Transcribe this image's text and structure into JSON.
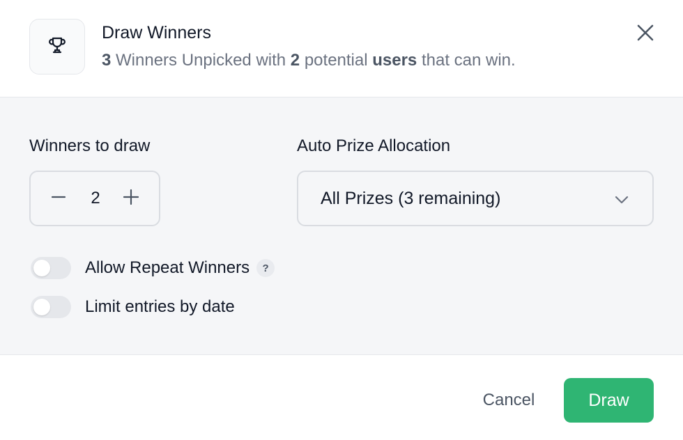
{
  "header": {
    "icon": "trophy-icon",
    "title": "Draw Winners",
    "subtitle": {
      "winners_count": "3",
      "text_1": " Winners Unpicked with ",
      "users_count": "2",
      "text_2": " potential ",
      "users_word": "users",
      "text_3": " that can win."
    },
    "close_icon": "close-icon"
  },
  "form": {
    "winners_label": "Winners to draw",
    "winners_value": "2",
    "decrement_icon": "minus-icon",
    "increment_icon": "plus-icon",
    "prize_label": "Auto Prize Allocation",
    "prize_selected": "All Prizes (3 remaining)",
    "prize_chevron": "chevron-down-icon",
    "repeat_label": "Allow Repeat Winners",
    "repeat_enabled": false,
    "help_glyph": "?",
    "limit_label": "Limit entries by date",
    "limit_enabled": false
  },
  "footer": {
    "cancel_label": "Cancel",
    "draw_label": "Draw"
  },
  "colors": {
    "accent": "#2fb573",
    "body_bg": "#f5f6f8",
    "border": "#d9dce1",
    "muted_text": "#6b7280"
  }
}
